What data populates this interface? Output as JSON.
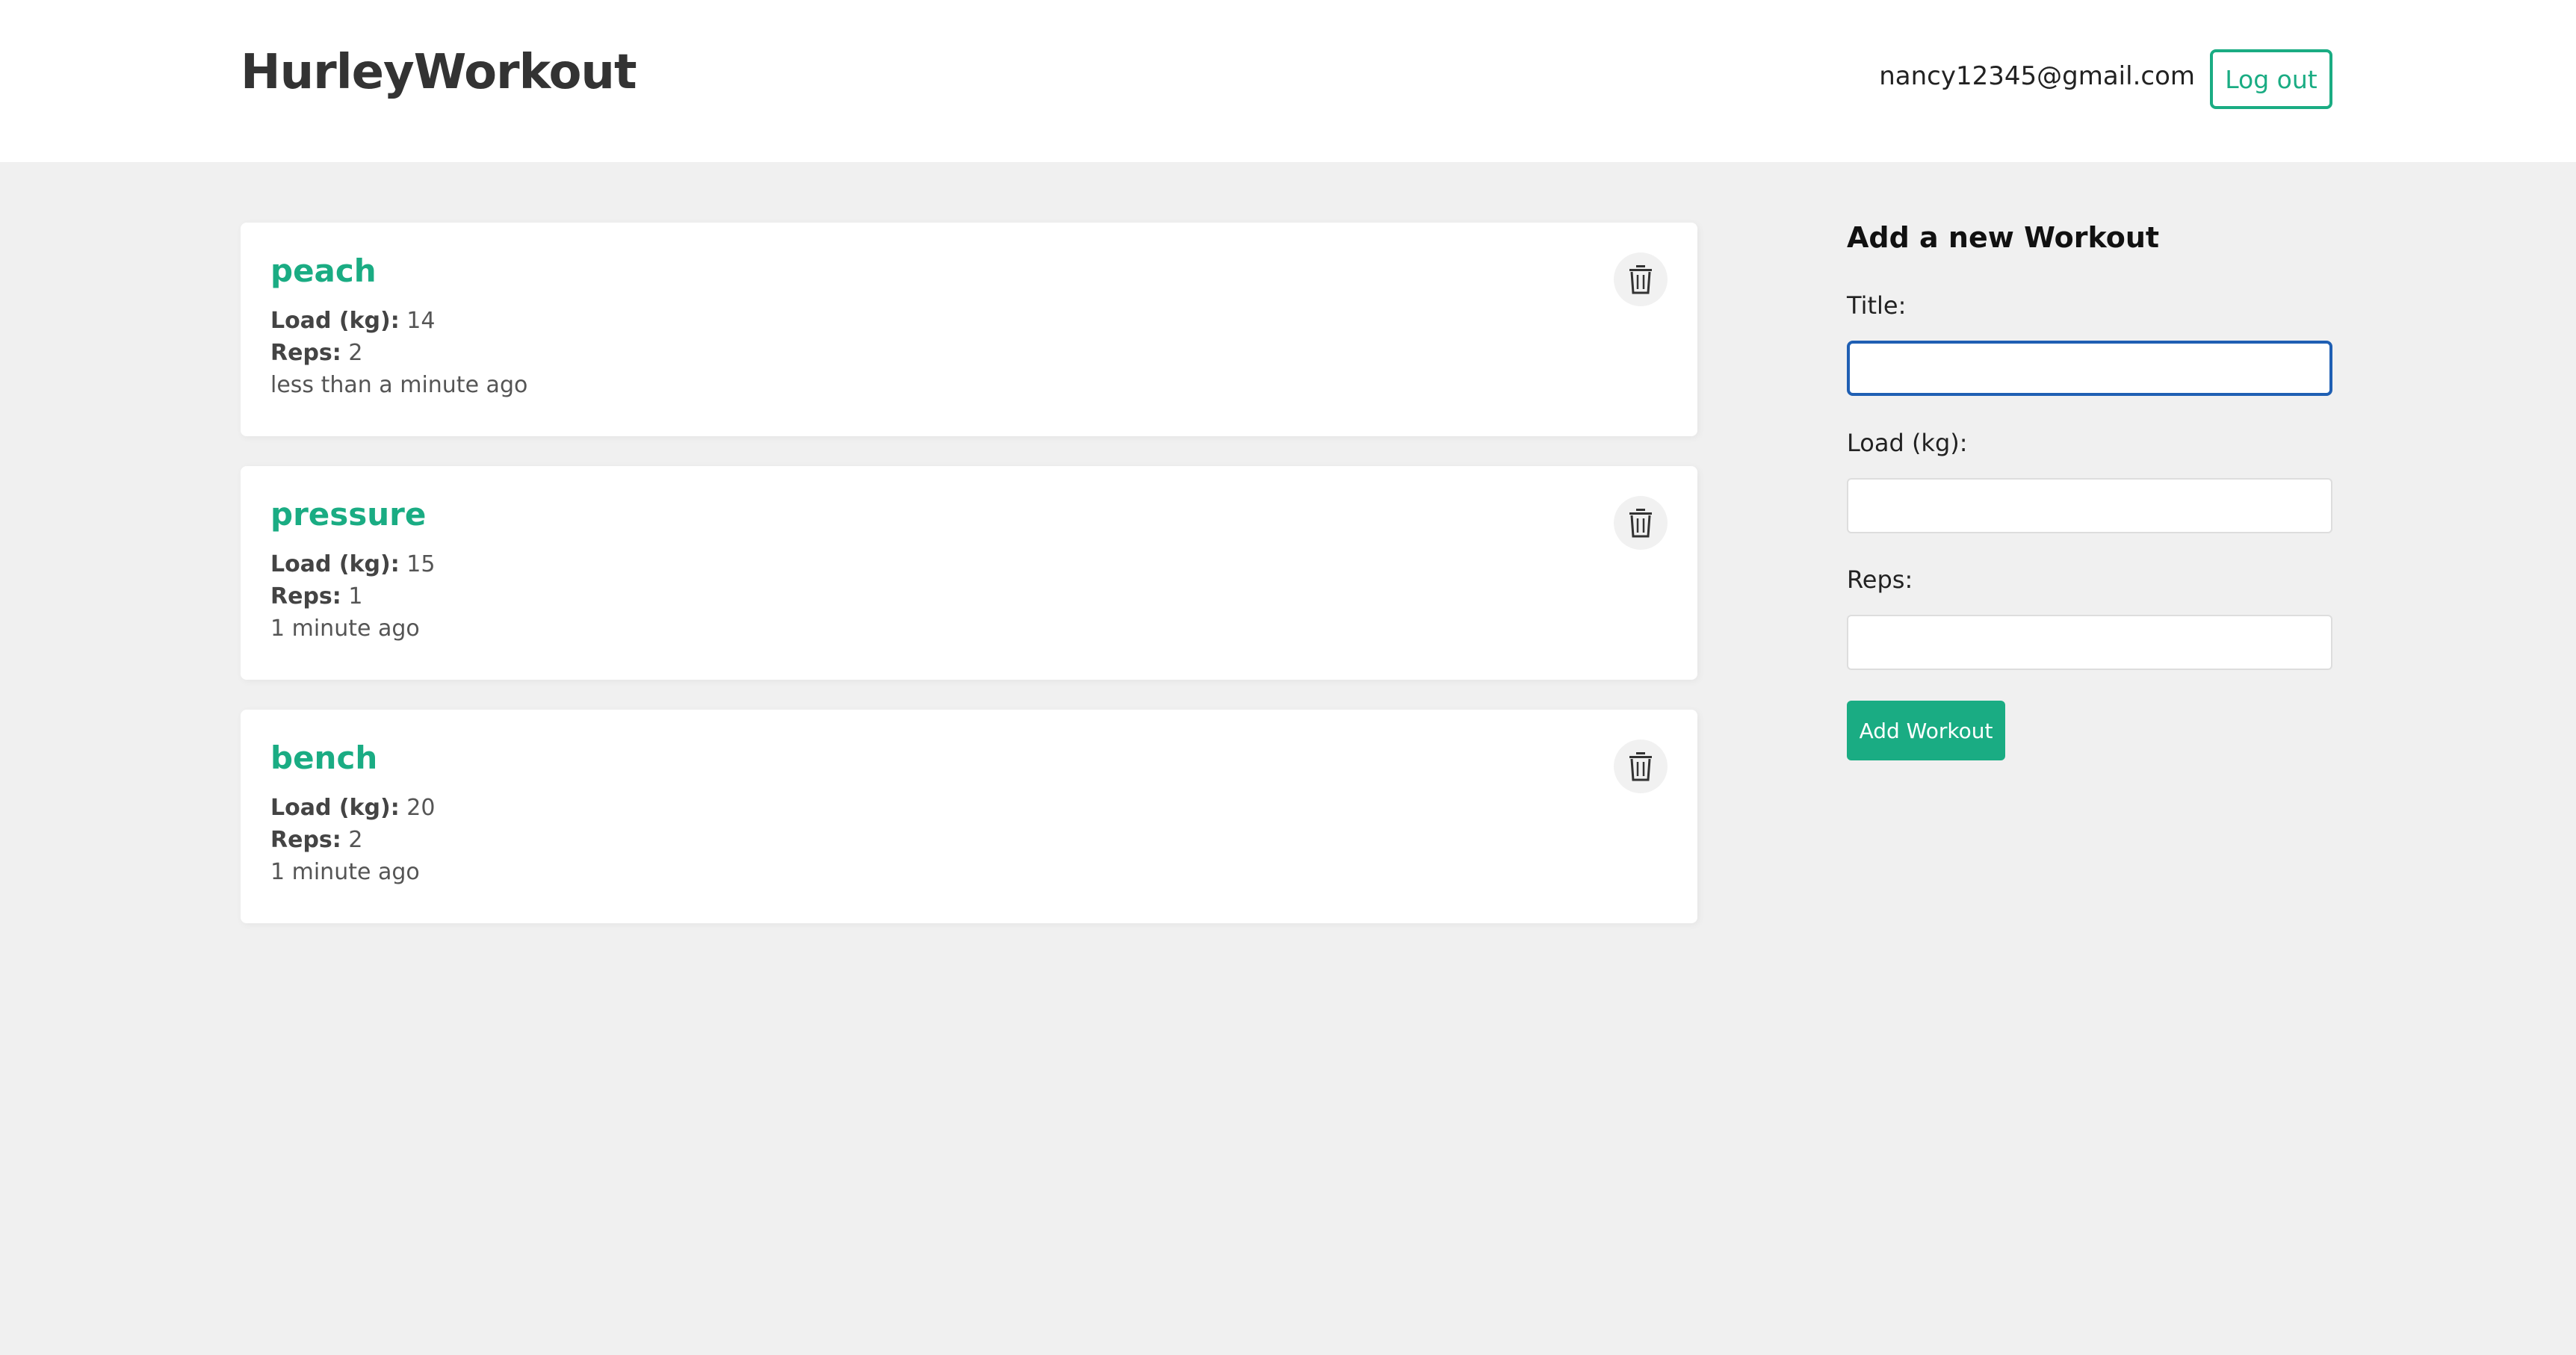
{
  "header": {
    "brand": "HurleyWorkout",
    "user_email": "nancy12345@gmail.com",
    "logout_label": "Log out"
  },
  "workouts": [
    {
      "title": "peach",
      "load_label": "Load (kg):",
      "load_value": "14",
      "reps_label": "Reps:",
      "reps_value": "2",
      "time_ago": "less than a minute ago"
    },
    {
      "title": "pressure",
      "load_label": "Load (kg):",
      "load_value": "15",
      "reps_label": "Reps:",
      "reps_value": "1",
      "time_ago": "1 minute ago"
    },
    {
      "title": "bench",
      "load_label": "Load (kg):",
      "load_value": "20",
      "reps_label": "Reps:",
      "reps_value": "2",
      "time_ago": "1 minute ago"
    }
  ],
  "form": {
    "heading": "Add a new Workout",
    "title_label": "Title:",
    "title_value": "",
    "load_label": "Load (kg):",
    "load_value": "",
    "reps_label": "Reps:",
    "reps_value": "",
    "submit_label": "Add Workout"
  },
  "icons": {
    "delete": "trash-icon"
  },
  "colors": {
    "accent": "#1aac83",
    "background": "#f0f0f0",
    "focus_border": "#1f5fb3"
  }
}
